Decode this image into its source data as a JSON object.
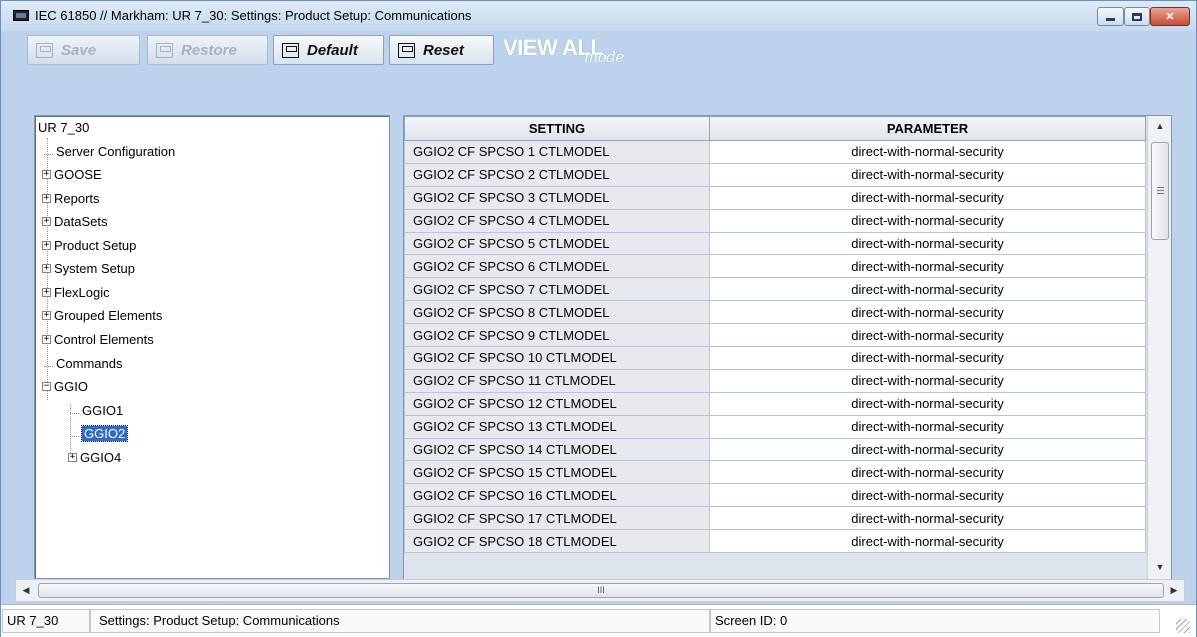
{
  "window": {
    "title": "IEC 61850 // Markham: UR 7_30: Settings: Product Setup: Communications",
    "controls": {
      "minimize": "minimize",
      "maximize": "maximize",
      "close": "✕"
    }
  },
  "toolbar": {
    "save_label": "Save",
    "restore_label": "Restore",
    "default_label": "Default",
    "reset_label": "Reset",
    "view_all_label": "VIEW ALL",
    "view_all_mode": "mode"
  },
  "tree": {
    "root": "UR 7_30",
    "items": [
      {
        "label": "Server Configuration"
      },
      {
        "label": "GOOSE"
      },
      {
        "label": "Reports"
      },
      {
        "label": "DataSets"
      },
      {
        "label": "Product Setup"
      },
      {
        "label": "System Setup"
      },
      {
        "label": "FlexLogic"
      },
      {
        "label": "Grouped Elements"
      },
      {
        "label": "Control Elements"
      },
      {
        "label": "Commands"
      },
      {
        "label": "GGIO"
      },
      {
        "label": "GGIO1"
      },
      {
        "label": "GGIO2"
      },
      {
        "label": "GGIO4"
      }
    ]
  },
  "grid": {
    "columns": [
      "SETTING",
      "PARAMETER"
    ],
    "rows": [
      {
        "setting": "GGIO2 CF SPCSO 1 CTLMODEL",
        "parameter": "direct-with-normal-security"
      },
      {
        "setting": "GGIO2 CF SPCSO 2 CTLMODEL",
        "parameter": "direct-with-normal-security"
      },
      {
        "setting": "GGIO2 CF SPCSO 3 CTLMODEL",
        "parameter": "direct-with-normal-security"
      },
      {
        "setting": "GGIO2 CF SPCSO 4 CTLMODEL",
        "parameter": "direct-with-normal-security"
      },
      {
        "setting": "GGIO2 CF SPCSO 5 CTLMODEL",
        "parameter": "direct-with-normal-security"
      },
      {
        "setting": "GGIO2 CF SPCSO 6 CTLMODEL",
        "parameter": "direct-with-normal-security"
      },
      {
        "setting": "GGIO2 CF SPCSO 7 CTLMODEL",
        "parameter": "direct-with-normal-security"
      },
      {
        "setting": "GGIO2 CF SPCSO 8 CTLMODEL",
        "parameter": "direct-with-normal-security"
      },
      {
        "setting": "GGIO2 CF SPCSO 9 CTLMODEL",
        "parameter": "direct-with-normal-security"
      },
      {
        "setting": "GGIO2 CF SPCSO 10 CTLMODEL",
        "parameter": "direct-with-normal-security"
      },
      {
        "setting": "GGIO2 CF SPCSO 11 CTLMODEL",
        "parameter": "direct-with-normal-security"
      },
      {
        "setting": "GGIO2 CF SPCSO 12 CTLMODEL",
        "parameter": "direct-with-normal-security"
      },
      {
        "setting": "GGIO2 CF SPCSO 13 CTLMODEL",
        "parameter": "direct-with-normal-security"
      },
      {
        "setting": "GGIO2 CF SPCSO 14 CTLMODEL",
        "parameter": "direct-with-normal-security"
      },
      {
        "setting": "GGIO2 CF SPCSO 15 CTLMODEL",
        "parameter": "direct-with-normal-security"
      },
      {
        "setting": "GGIO2 CF SPCSO 16 CTLMODEL",
        "parameter": "direct-with-normal-security"
      },
      {
        "setting": "GGIO2 CF SPCSO 17 CTLMODEL",
        "parameter": "direct-with-normal-security"
      },
      {
        "setting": "GGIO2 CF SPCSO 18 CTLMODEL",
        "parameter": "direct-with-normal-security"
      }
    ]
  },
  "hscroll": {
    "thumb_grip": "III"
  },
  "status": {
    "device": "UR 7_30",
    "path": "Settings: Product Setup: Communications",
    "screen_id": "Screen ID: 0"
  }
}
